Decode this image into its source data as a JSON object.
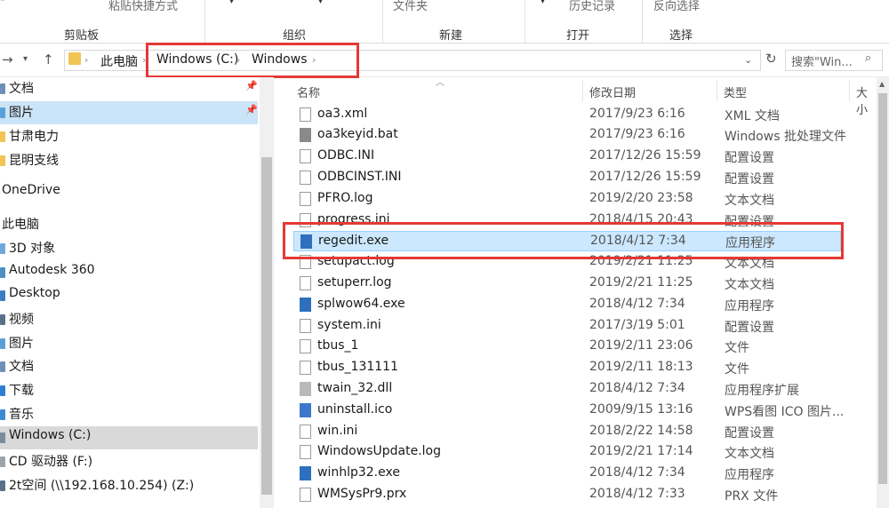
{
  "ribbon": {
    "paste_shortcut_label": "粘贴快捷方式",
    "new_folder_label": "文件夹",
    "history_label": "历史记录",
    "invert_select_label": "反向选择",
    "groups": [
      "剪贴板",
      "组织",
      "新建",
      "打开",
      "选择"
    ]
  },
  "address": {
    "crumbs": [
      "此电脑",
      "Windows (C:)",
      "Windows"
    ],
    "search_placeholder": "搜索\"Win..."
  },
  "sidebar": {
    "items": [
      {
        "label": "文档",
        "pinned": true
      },
      {
        "label": "图片",
        "pinned": true
      },
      {
        "label": "甘肃电力"
      },
      {
        "label": "昆明支线"
      },
      {
        "label": "OneDrive"
      },
      {
        "label": "此电脑"
      },
      {
        "label": "3D 对象"
      },
      {
        "label": "Autodesk 360"
      },
      {
        "label": "Desktop"
      },
      {
        "label": "视频"
      },
      {
        "label": "图片"
      },
      {
        "label": "文档"
      },
      {
        "label": "下载"
      },
      {
        "label": "音乐"
      },
      {
        "label": "Windows (C:)"
      },
      {
        "label": "CD 驱动器 (F:)"
      },
      {
        "label": "2t空间 (\\\\192.168.10.254) (Z:)"
      }
    ]
  },
  "columns": {
    "name": "名称",
    "date": "修改日期",
    "type": "类型",
    "size": "大小"
  },
  "files": [
    {
      "name": "oa3.xml",
      "date": "2017/9/23 6:16",
      "type": "XML 文档"
    },
    {
      "name": "oa3keyid.bat",
      "date": "2017/9/23 6:16",
      "type": "Windows 批处理文件"
    },
    {
      "name": "ODBC.INI",
      "date": "2017/12/26 15:59",
      "type": "配置设置"
    },
    {
      "name": "ODBCINST.INI",
      "date": "2017/12/26 15:59",
      "type": "配置设置"
    },
    {
      "name": "PFRO.log",
      "date": "2019/2/20 23:58",
      "type": "文本文档"
    },
    {
      "name": "progress.ini",
      "date": "2018/4/15 20:43",
      "type": "配置设置"
    },
    {
      "name": "regedit.exe",
      "date": "2018/4/12 7:34",
      "type": "应用程序"
    },
    {
      "name": "setupact.log",
      "date": "2019/2/21 11:25",
      "type": "文本文档"
    },
    {
      "name": "setuperr.log",
      "date": "2019/2/21 11:25",
      "type": "文本文档"
    },
    {
      "name": "splwow64.exe",
      "date": "2018/4/12 7:34",
      "type": "应用程序"
    },
    {
      "name": "system.ini",
      "date": "2017/3/19 5:01",
      "type": "配置设置"
    },
    {
      "name": "tbus_1",
      "date": "2019/2/11 23:06",
      "type": "文件"
    },
    {
      "name": "tbus_131111",
      "date": "2019/2/11 18:13",
      "type": "文件"
    },
    {
      "name": "twain_32.dll",
      "date": "2018/4/12 7:34",
      "type": "应用程序扩展"
    },
    {
      "name": "uninstall.ico",
      "date": "2009/9/15 13:16",
      "type": "WPS看图 ICO 图片..."
    },
    {
      "name": "win.ini",
      "date": "2018/2/22 14:58",
      "type": "配置设置"
    },
    {
      "name": "WindowsUpdate.log",
      "date": "2019/2/21 17:14",
      "type": "文本文档"
    },
    {
      "name": "winhlp32.exe",
      "date": "2018/4/12 7:34",
      "type": "应用程序"
    },
    {
      "name": "WMSysPr9.prx",
      "date": "2018/4/12 7:33",
      "type": "PRX 文件"
    }
  ]
}
